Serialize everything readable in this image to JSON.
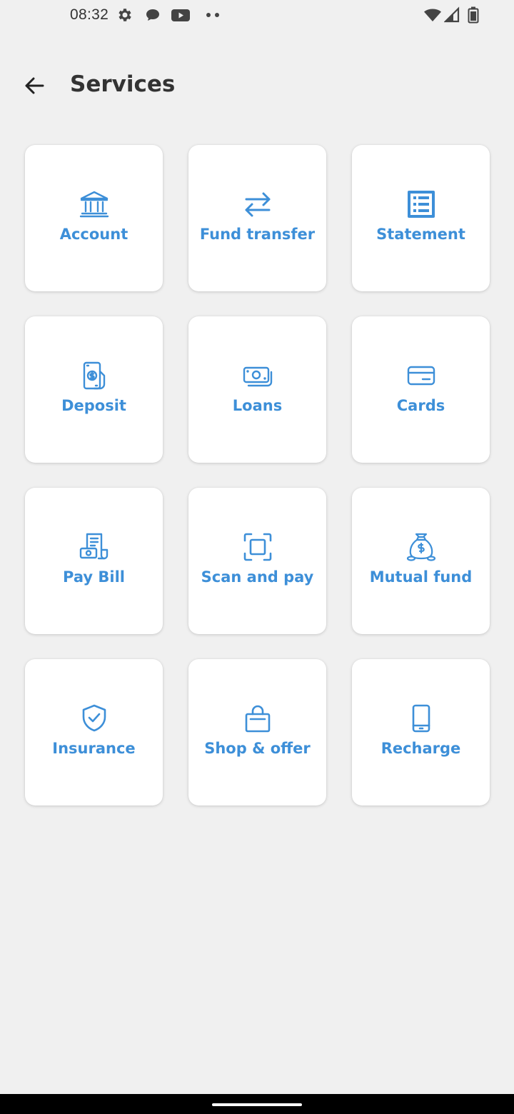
{
  "status_bar": {
    "time": "08:32",
    "icons": [
      "gear-icon",
      "chat-bubble-icon",
      "youtube-icon",
      "more-dots-icon",
      "wifi-icon",
      "signal-icon",
      "battery-icon"
    ]
  },
  "app_bar": {
    "title": "Services",
    "back_icon": "arrow-left-icon"
  },
  "colors": {
    "accent": "#3d8fd8",
    "background": "#f0f0f0",
    "tile_background": "#ffffff",
    "title_text": "#333333"
  },
  "services": [
    {
      "label": "Account",
      "icon": "bank-icon"
    },
    {
      "label": "Fund transfer",
      "icon": "transfer-arrows-icon"
    },
    {
      "label": "Statement",
      "icon": "statement-list-icon"
    },
    {
      "label": "Deposit",
      "icon": "deposit-icon"
    },
    {
      "label": "Loans",
      "icon": "cash-icon"
    },
    {
      "label": "Cards",
      "icon": "credit-card-icon"
    },
    {
      "label": "Pay Bill",
      "icon": "bill-icon"
    },
    {
      "label": "Scan and pay",
      "icon": "scan-icon"
    },
    {
      "label": "Mutual fund",
      "icon": "money-bag-icon"
    },
    {
      "label": "Insurance",
      "icon": "shield-check-icon"
    },
    {
      "label": "Shop & offer",
      "icon": "shopping-bag-icon"
    },
    {
      "label": "Recharge",
      "icon": "mobile-phone-icon"
    }
  ]
}
